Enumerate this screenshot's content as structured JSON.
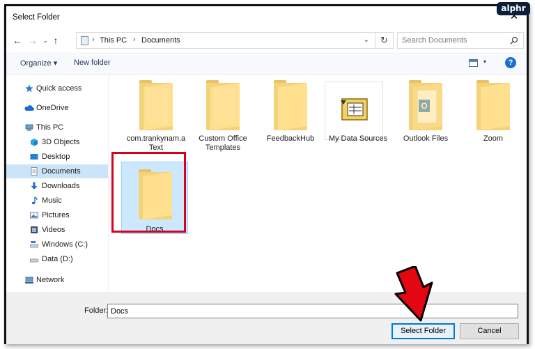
{
  "window": {
    "title": "Select Folder",
    "close_glyph": "✕"
  },
  "watermark": "alphr",
  "nav": {
    "back": "←",
    "forward": "→",
    "recent": "⌄",
    "up": "↑",
    "address": [
      "This PC",
      "Documents"
    ],
    "address_sep": "›",
    "dropdown": "⌄",
    "refresh": "↻",
    "search_placeholder": "Search Documents"
  },
  "toolbar": {
    "organize": "Organize ▾",
    "new_folder": "New folder",
    "view_caret": "▾",
    "help": "?"
  },
  "sidebar": {
    "items": [
      {
        "label": "Quick access",
        "icon": "star-icon"
      },
      {
        "label": "OneDrive",
        "icon": "cloud-icon"
      },
      {
        "label": "This PC",
        "icon": "computer-icon"
      },
      {
        "label": "3D Objects",
        "icon": "cube-icon"
      },
      {
        "label": "Desktop",
        "icon": "desktop-icon"
      },
      {
        "label": "Documents",
        "icon": "document-icon",
        "selected": true
      },
      {
        "label": "Downloads",
        "icon": "download-icon"
      },
      {
        "label": "Music",
        "icon": "music-icon"
      },
      {
        "label": "Pictures",
        "icon": "pictures-icon"
      },
      {
        "label": "Videos",
        "icon": "video-icon"
      },
      {
        "label": "Windows (C:)",
        "icon": "drive-icon"
      },
      {
        "label": "Data (D:)",
        "icon": "drive-icon"
      },
      {
        "label": "Network",
        "icon": "network-icon"
      }
    ]
  },
  "files": [
    {
      "label": "com.trankynam.a Text",
      "kind": "folder-papers"
    },
    {
      "label": "Custom Office Templates",
      "kind": "folder-papers"
    },
    {
      "label": "FeedbackHub",
      "kind": "folder"
    },
    {
      "label": "My Data Sources",
      "kind": "data-sources"
    },
    {
      "label": "Outlook Files",
      "kind": "folder-outlook"
    },
    {
      "label": "Zoom",
      "kind": "folder"
    },
    {
      "label": "Docs",
      "kind": "folder",
      "selected": true
    }
  ],
  "footer": {
    "folder_label": "Folder:",
    "folder_value": "Docs",
    "select_button": "Select Folder",
    "cancel_button": "Cancel"
  },
  "colors": {
    "accent": "#0078d7",
    "highlight": "#d9001b",
    "selection": "#cce8ff"
  }
}
